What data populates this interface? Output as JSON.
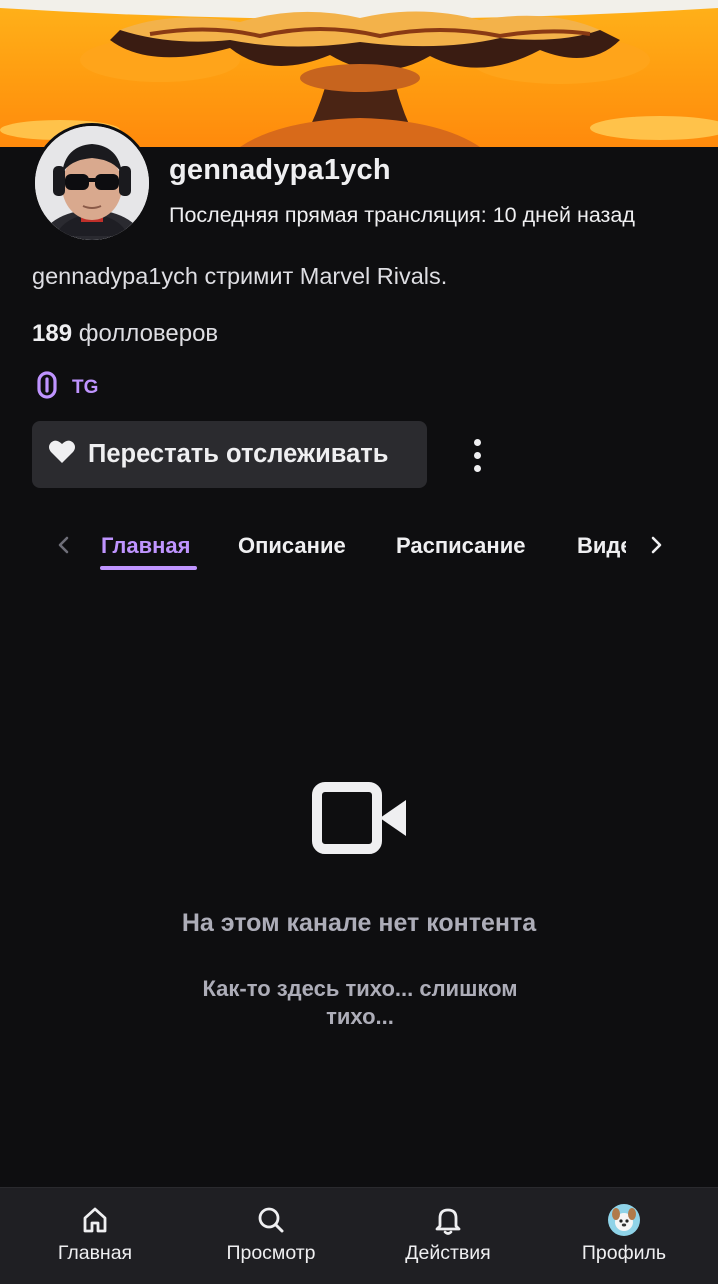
{
  "channel": {
    "name": "gennadypa1ych",
    "last_stream": "Последняя прямая трансляция: 10 дней назад",
    "bio": "gennadypa1ych стримит Marvel Rivals.",
    "followers_count": "189",
    "followers_label": "фолловеров"
  },
  "social": {
    "label": "TG",
    "icon": "link-icon"
  },
  "actions": {
    "unfollow_label": "Перестать отслеживать",
    "unfollow_icon": "heart-icon",
    "more_icon": "more-vertical-icon"
  },
  "tabs": [
    {
      "label": "Главная",
      "active": true
    },
    {
      "label": "Описание",
      "active": false
    },
    {
      "label": "Расписание",
      "active": false
    },
    {
      "label": "Видео",
      "active": false
    }
  ],
  "empty_state": {
    "icon": "video-camera-icon",
    "title": "На этом канале нет контента",
    "subtitle": "Как-то здесь тихо... слишком тихо..."
  },
  "bottom_nav": [
    {
      "label": "Главная",
      "icon": "home-icon"
    },
    {
      "label": "Просмотр",
      "icon": "search-icon"
    },
    {
      "label": "Действия",
      "icon": "bell-icon"
    },
    {
      "label": "Профиль",
      "icon": "profile-avatar"
    }
  ],
  "colors": {
    "background": "#0e0e10",
    "accent": "#bf94ff",
    "button_bg": "#2b2b2f",
    "muted_text": "#adadb8",
    "nav_bg": "#1f1f23"
  }
}
